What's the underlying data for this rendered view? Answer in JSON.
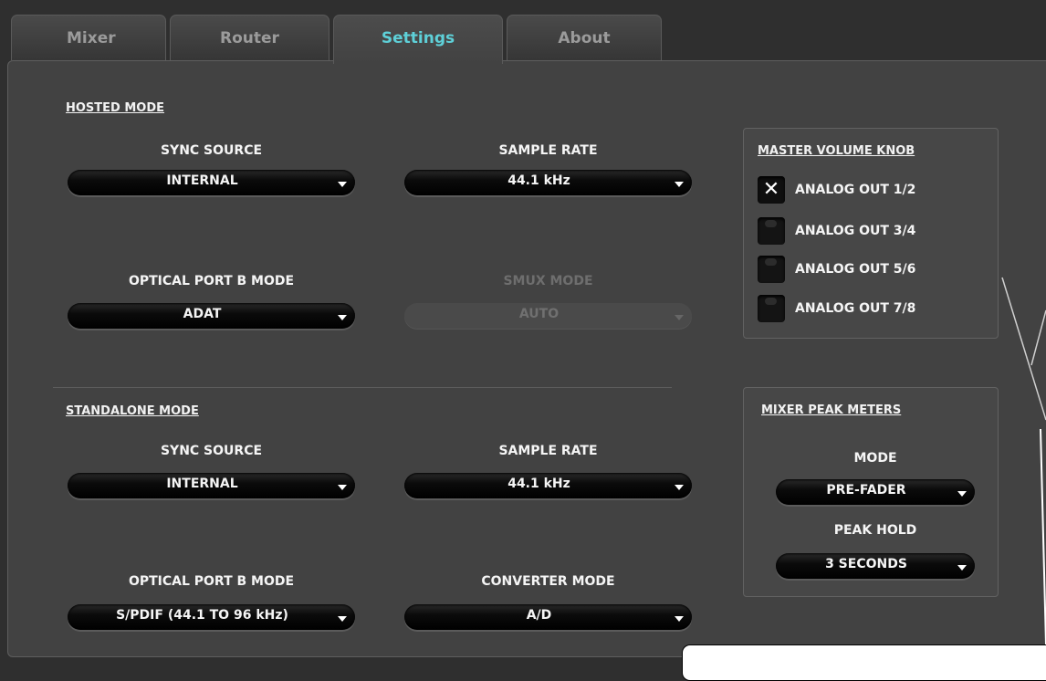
{
  "tabs": [
    {
      "label": "Mixer"
    },
    {
      "label": "Router"
    },
    {
      "label": "Settings",
      "active": true
    },
    {
      "label": "About"
    }
  ],
  "hosted": {
    "title": "HOSTED MODE",
    "sync_source": {
      "label": "SYNC SOURCE",
      "value": "INTERNAL"
    },
    "sample_rate": {
      "label": "SAMPLE RATE",
      "value": "44.1 kHz"
    },
    "optical_b": {
      "label": "OPTICAL PORT B MODE",
      "value": "ADAT"
    },
    "smux": {
      "label": "SMUX MODE",
      "value": "AUTO",
      "disabled": true
    }
  },
  "standalone": {
    "title": "STANDALONE MODE",
    "sync_source": {
      "label": "SYNC SOURCE",
      "value": "INTERNAL"
    },
    "sample_rate": {
      "label": "SAMPLE RATE",
      "value": "44.1 kHz"
    },
    "optical_b": {
      "label": "OPTICAL PORT B MODE",
      "value": "S/PDIF (44.1 TO 96 kHz)"
    },
    "converter": {
      "label": "CONVERTER MODE",
      "value": "A/D"
    }
  },
  "master_volume": {
    "title": "MASTER VOLUME KNOB",
    "outputs": [
      {
        "label": "ANALOG OUT 1/2",
        "checked": true
      },
      {
        "label": "ANALOG OUT 3/4",
        "checked": false
      },
      {
        "label": "ANALOG OUT 5/6",
        "checked": false
      },
      {
        "label": "ANALOG OUT 7/8",
        "checked": false
      }
    ]
  },
  "peak_meters": {
    "title": "MIXER PEAK METERS",
    "mode": {
      "label": "MODE",
      "value": "PRE-FADER"
    },
    "peak_hold": {
      "label": "PEAK HOLD",
      "value": "3 SECONDS"
    }
  },
  "icons": {
    "dropdown_caret": "caret-down-icon",
    "check_mark": "x-mark-icon"
  },
  "colors": {
    "active_tab_text": "#5ed0d8",
    "inactive_tab_text": "#9b9b9b",
    "panel_bg": "#424242",
    "window_bg": "#2f2f2f"
  }
}
